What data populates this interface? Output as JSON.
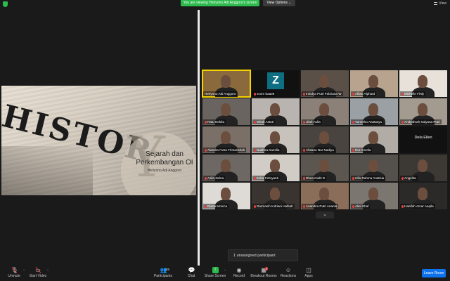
{
  "topbar": {
    "share_banner": "You are viewing Heriyono Adi Anggoro's screen",
    "view_options": "View Options ⌄",
    "view_label": "View"
  },
  "slide": {
    "word": "HISTOR",
    "big_letter": "Y",
    "title": "Sejarah dan Perkembangan OI",
    "author": "Heriyono Adi Anggoro"
  },
  "participants": [
    {
      "name": "Heriyono Adi Anggoro",
      "muted": false,
      "style": "video",
      "active": true,
      "bg": "#8a6a3c"
    },
    {
      "name": "zoom baa06",
      "muted": true,
      "style": "avatar",
      "initial": "Z",
      "bg": "#111111"
    },
    {
      "name": "Inindya Putri Febriana W",
      "muted": true,
      "style": "video",
      "bg": "#5a5048"
    },
    {
      "name": "Alfian Alphard",
      "muted": true,
      "style": "video",
      "bg": "#b8a48e"
    },
    {
      "name": "Michelle Firtly",
      "muted": true,
      "style": "video",
      "bg": "#e7e1da"
    },
    {
      "name": "Ratu Nebila",
      "muted": true,
      "style": "video",
      "bg": "#6a6460"
    },
    {
      "name": "Windi Astuti",
      "muted": true,
      "style": "video",
      "bg": "#b9b4b0"
    },
    {
      "name": "Jilah Aulia",
      "muted": true,
      "style": "video",
      "bg": "#8b8178"
    },
    {
      "name": "Vanesha Anatasya",
      "muted": true,
      "style": "video",
      "bg": "#9aa0a4"
    },
    {
      "name": "Andyahrah Kalyana Putri",
      "muted": true,
      "style": "video",
      "bg": "#a39a90"
    },
    {
      "name": "Alandra Futra Firmanshah",
      "muted": true,
      "style": "video",
      "bg": "#7a7068"
    },
    {
      "name": "Nadhira Kamilia",
      "muted": true,
      "style": "video",
      "bg": "#c8c2bc"
    },
    {
      "name": "Ahsanu Nur Nadiya",
      "muted": true,
      "style": "video",
      "bg": "#4a4440"
    },
    {
      "name": "Nur Amelia",
      "muted": true,
      "style": "video",
      "bg": "#b2aca6"
    },
    {
      "name": "Dela Ellen",
      "muted": true,
      "style": "name",
      "bg": "#111111"
    },
    {
      "name": "Azila Zahra",
      "muted": true,
      "style": "video",
      "bg": "#6e6864"
    },
    {
      "name": "Echa Febryanti",
      "muted": true,
      "style": "video",
      "bg": "#d2ccc6"
    },
    {
      "name": "Dhea Dialti R",
      "muted": true,
      "style": "video",
      "bg": "#5c5650"
    },
    {
      "name": "Ulfa Rahma Yustisia",
      "muted": true,
      "style": "video",
      "bg": "#54504c"
    },
    {
      "name": "Angelita",
      "muted": true,
      "style": "video",
      "bg": "#3c3834"
    },
    {
      "name": "Diana Monica",
      "muted": true,
      "style": "video",
      "bg": "#dedad6"
    },
    {
      "name": "Darmasih Indriani Hafsah",
      "muted": true,
      "style": "video",
      "bg": "#3a3430"
    },
    {
      "name": "Anandita Putri Ananta",
      "muted": true,
      "style": "video",
      "bg": "#8a6e5a"
    },
    {
      "name": "Aliel Shaf",
      "muted": true,
      "style": "video",
      "bg": "#7c7670"
    },
    {
      "name": "Hanifah Amar Aaqila",
      "muted": true,
      "style": "video",
      "bg": "#2c2a28"
    }
  ],
  "gallery_more": "⌄",
  "unassigned": "1 unassigned participant",
  "toolbar": {
    "unmute": "Unmute",
    "start_video": "Start Video",
    "participants": "Participants",
    "participants_count": "39",
    "chat": "Chat",
    "share_screen": "Share Screen",
    "record": "Record",
    "breakout_rooms": "Breakout Rooms",
    "breakout_badge": "1",
    "reactions": "Reactions",
    "apps": "Apps",
    "leave_room": "Leave Room"
  }
}
